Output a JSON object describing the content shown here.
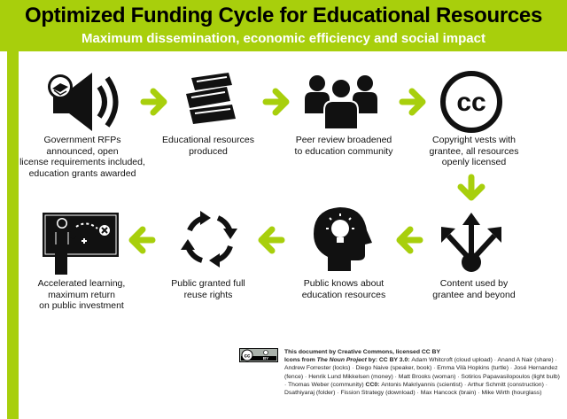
{
  "header": {
    "title": "Optimized Funding Cycle for Educational Resources",
    "subtitle": "Maximum dissemination, economic efficiency and social impact"
  },
  "steps": [
    {
      "icon": "speaker-book-icon",
      "lines": [
        "Government RFPs",
        "announced, open",
        "license requirements included,",
        "education grants awarded"
      ]
    },
    {
      "icon": "books-icon",
      "lines": [
        "Educational resources",
        "produced"
      ]
    },
    {
      "icon": "people-group-icon",
      "lines": [
        "Peer review broadened",
        "to education community"
      ]
    },
    {
      "icon": "creative-commons-icon",
      "cc_text": "cc",
      "lines": [
        "Copyright vests with",
        "grantee, all resources",
        "openly licensed"
      ]
    },
    {
      "icon": "distribution-arrows-icon",
      "lines": [
        "Content used by",
        "grantee and beyond"
      ]
    },
    {
      "icon": "brain-lightbulb-icon",
      "lines": [
        "Public knows about",
        "education resources"
      ]
    },
    {
      "icon": "cycle-arrows-icon",
      "lines": [
        "Public granted full",
        "reuse rights"
      ]
    },
    {
      "icon": "teacher-board-icon",
      "lines": [
        "Accelerated learning,",
        "maximum return",
        "on public investment"
      ]
    }
  ],
  "credits": {
    "line1": "This document by Creative Commons, licensed CC BY",
    "icons_prefix": "Icons from ",
    "icons_source": "The Noun Project",
    "icons_license": " by: CC BY 3.0: ",
    "attributions_ccby": "Adam Whitcroft (cloud upload) · Anand A Nair (share) · Andrew Forrester (locks) · Diego Naive (speaker, book) · Emma Vilà Hopkins (turtle) · José Hernandez (fence) · Henrik Lund Mikkelsen (money) · Matt Brooks (woman) · Sotirios Papavasilopoulos (light bulb) · Thomas Weber (community)",
    "cc0_label": " CC0: ",
    "attributions_cc0": "Antonis Makriyannis (scientist) · Arthur Schmitt (construction) · Dsathiyaraj (folder) · Fission Strategy (download) · Max Hancock (brain) · Mike Wirth (hourglass)"
  },
  "badge": {
    "cc": "cc",
    "by": "BY"
  },
  "colors": {
    "accent": "#a8cf0c",
    "ink": "#111111",
    "white": "#ffffff"
  }
}
